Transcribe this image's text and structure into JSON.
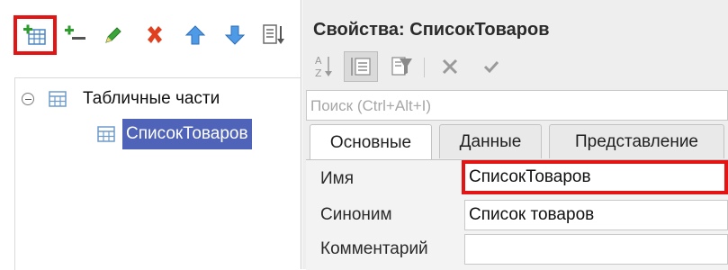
{
  "left_toolbar": {
    "buttons": [
      {
        "name": "add-tabular-section-button",
        "icon": "table-add-icon"
      },
      {
        "name": "add-attribute-button",
        "icon": "plus-line-icon"
      },
      {
        "name": "edit-button",
        "icon": "pencil-icon"
      },
      {
        "name": "delete-button",
        "icon": "red-x-icon"
      },
      {
        "name": "move-up-button",
        "icon": "arrow-up-icon"
      },
      {
        "name": "move-down-button",
        "icon": "arrow-down-icon"
      },
      {
        "name": "sort-button",
        "icon": "list-sort-icon"
      }
    ]
  },
  "tree": {
    "root_label": "Табличные части",
    "child_label": "СписокТоваров"
  },
  "properties": {
    "title": "Свойства: СписокТоваров",
    "search_placeholder": "Поиск (Ctrl+Alt+I)",
    "tabs": [
      "Основные",
      "Данные",
      "Представление"
    ],
    "active_tab": "Основные",
    "fields": [
      {
        "label": "Имя",
        "value": "СписокТоваров"
      },
      {
        "label": "Синоним",
        "value": "Список товаров"
      },
      {
        "label": "Комментарий",
        "value": ""
      }
    ]
  },
  "colors": {
    "highlight": "#e21414",
    "selection": "#4f63b8",
    "accent_green": "#2e9b2e",
    "accent_red": "#e0401f",
    "accent_blue": "#3d8ce0"
  }
}
